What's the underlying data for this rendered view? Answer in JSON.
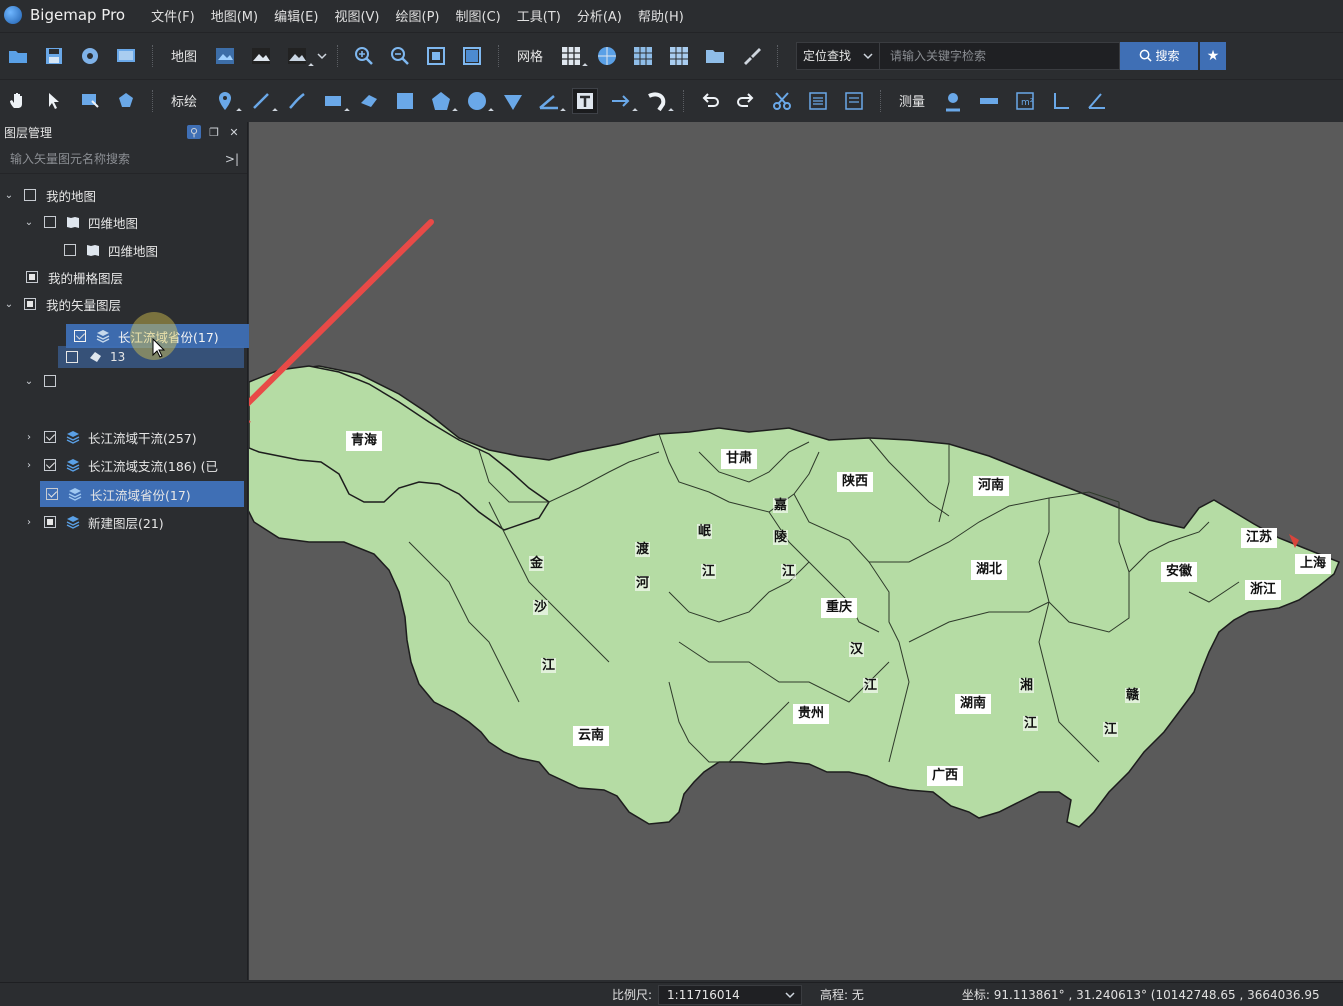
{
  "app": {
    "name": "Bigemap Pro"
  },
  "menu": [
    "文件(F)",
    "地图(M)",
    "编辑(E)",
    "视图(V)",
    "绘图(P)",
    "制图(C)",
    "工具(T)",
    "分析(A)",
    "帮助(H)"
  ],
  "toolbar1": {
    "map_label": "地图",
    "grid_label": "网格",
    "locate_select": "定位查找",
    "search_placeholder": "请输入关键字检索",
    "search_button": "搜索"
  },
  "toolbar2": {
    "draw_label": "标绘",
    "measure_label": "测量"
  },
  "layer_panel": {
    "title": "图层管理",
    "search_placeholder": "输入矢量图元名称搜索",
    "items": [
      {
        "label": "我的地图"
      },
      {
        "label": "四维地图"
      },
      {
        "label": "四维地图"
      },
      {
        "label": "我的栅格图层"
      },
      {
        "label": "我的矢量图层"
      },
      {
        "label": ""
      },
      {
        "label": "13"
      },
      {
        "label": "长江流域干流(257)"
      },
      {
        "label": "长江流域支流(186) (已"
      },
      {
        "label": "长江流域省份(17)"
      },
      {
        "label": "新建图层(21)"
      }
    ],
    "drag_label": "长江流域省份(17)"
  },
  "map": {
    "fill_color": "#b5dca4",
    "background_color": "#5a5a5a",
    "arrow_color": "#e84a47",
    "provinces": [
      "青海",
      "甘肃",
      "陕西",
      "河南",
      "江苏",
      "上海",
      "安徽",
      "浙江",
      "湖北",
      "重庆",
      "湖南",
      "贵州",
      "云南",
      "广西"
    ],
    "rivers": [
      "金",
      "沙",
      "江",
      "岷",
      "江",
      "嘉",
      "陵",
      "江",
      "汉",
      "江",
      "湘",
      "江",
      "赣",
      "江",
      "渡",
      "河"
    ]
  },
  "status": {
    "scale_label": "比例尺:",
    "scale_value": "1:11716014",
    "elevation": "高程: 无",
    "coords": "坐标: 91.113861° , 31.240613°  (10142748.65 , 3664036.95"
  }
}
